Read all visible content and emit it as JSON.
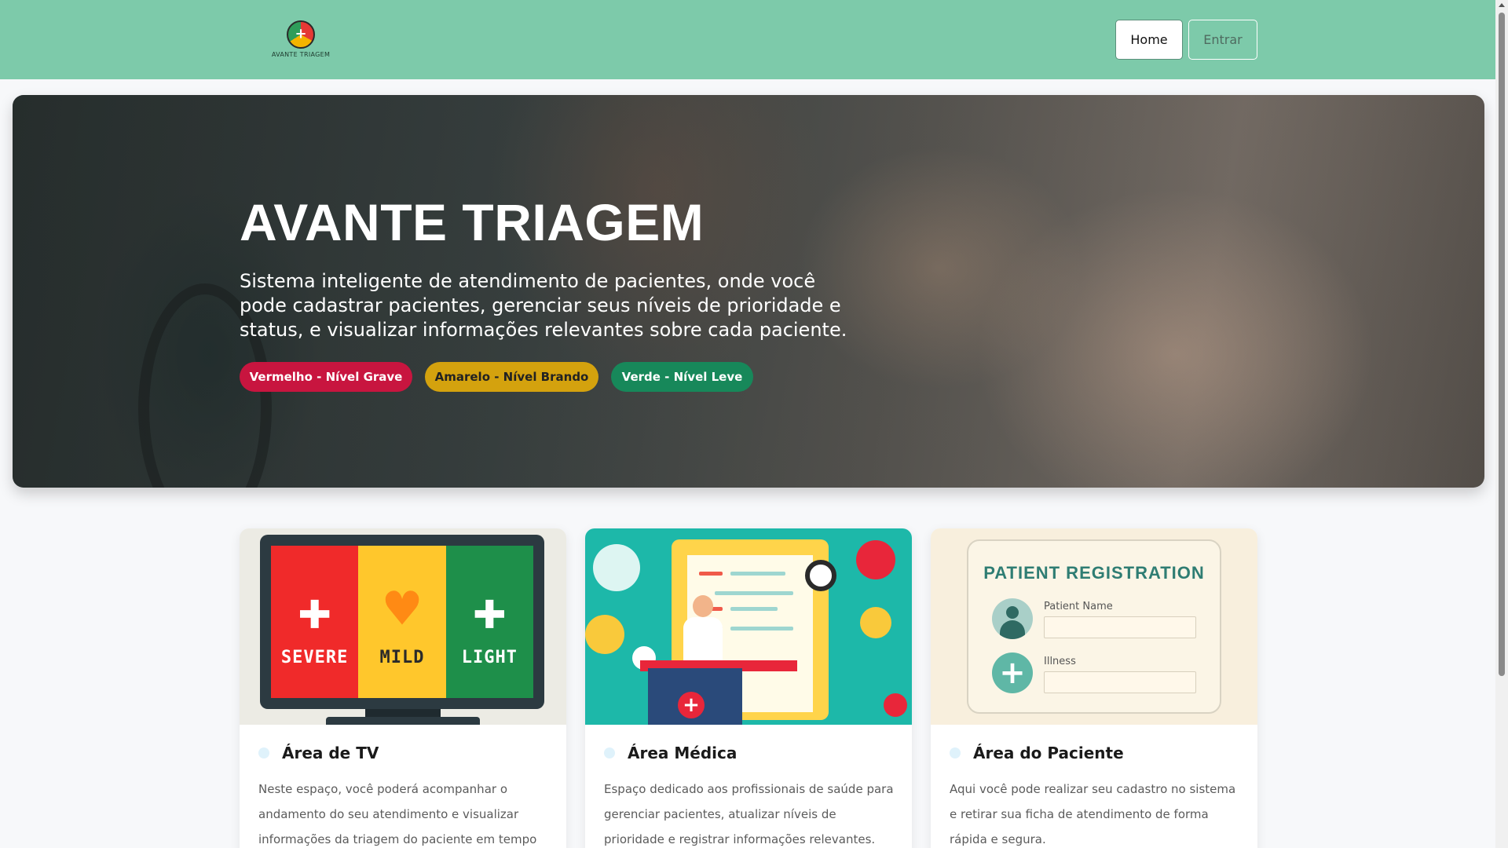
{
  "header": {
    "logo_text": "AVANTE TRIAGEM",
    "nav": {
      "home_label": "Home",
      "entrar_label": "Entrar"
    }
  },
  "hero": {
    "title": "AVANTE TRIAGEM",
    "description": "Sistema inteligente de atendimento de pacientes, onde você pode cadastrar pacientes, gerenciar seus níveis de prioridade e status, e visualizar informações relevantes sobre cada paciente.",
    "levels": [
      {
        "label": "Vermelho - Nível Grave",
        "color": "#c8153f"
      },
      {
        "label": "Amarelo - Nível Brando",
        "color": "#d4a20e"
      },
      {
        "label": "Verde - Nível Leve",
        "color": "#17885a"
      }
    ]
  },
  "cards": [
    {
      "title": "Área de TV",
      "description": "Neste espaço, você poderá acompanhar o andamento do seu atendimento e visualizar informações da triagem do paciente em tempo",
      "image": {
        "labels": [
          "SEVERE",
          "MILD",
          "LIGHT"
        ]
      }
    },
    {
      "title": "Área Médica",
      "description": "Espaço dedicado aos profissionais de saúde para gerenciar pacientes, atualizar níveis de prioridade e registrar informações relevantes."
    },
    {
      "title": "Área do Paciente",
      "description": "Aqui você pode realizar seu cadastro no sistema e retirar sua ficha de atendimento de forma rápida e segura.",
      "image": {
        "title": "PATIENT REGISTRATION",
        "field1": "Patient Name",
        "field2": "Illness"
      }
    }
  ],
  "colors": {
    "header_bg": "#7dcaaa",
    "accent_red": "#c8153f",
    "accent_yellow": "#d4a20e",
    "accent_green": "#17885a"
  }
}
